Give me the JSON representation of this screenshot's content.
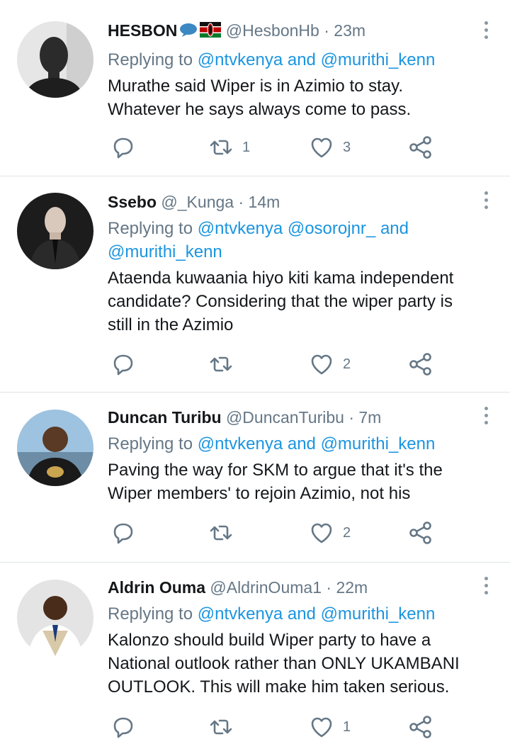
{
  "tweets": [
    {
      "name": "HESBON",
      "handle": "@HesbonHb",
      "dot": "·",
      "time": "23m",
      "reply_prefix": "Replying to",
      "reply_mention1": "@ntvkenya",
      "reply_and": "and",
      "reply_mention2": "@murithi_kenn",
      "text1": "Murathe said Wiper is in Azimio to stay.",
      "text2": "Whatever he says always come to pass.",
      "retweets": "1",
      "likes": "3"
    },
    {
      "name": "Ssebo",
      "handle": "@_Kunga",
      "dot": "·",
      "time": "14m",
      "reply_prefix": "Replying to",
      "reply_mention1": "@ntvkenya",
      "reply_mention2": "@osorojnr_",
      "reply_and": "and",
      "reply_mention3": "@murithi_kenn",
      "text1": "Ataenda kuwaania hiyo kiti kama independent",
      "text2": "candidate? Considering that the wiper party is",
      "text3": "still in the Azimio",
      "retweets": "",
      "likes": "2"
    },
    {
      "name": "Duncan Turibu",
      "handle": "@DuncanTuribu",
      "dot": "·",
      "time": "7m",
      "reply_prefix": "Replying to",
      "reply_mention1": "@ntvkenya",
      "reply_and": "and",
      "reply_mention2": "@murithi_kenn",
      "text1": "Paving the way for SKM to argue that it's the",
      "text2": "Wiper members' to rejoin Azimio, not his",
      "retweets": "",
      "likes": "2"
    },
    {
      "name": "Aldrin Ouma",
      "handle": "@AldrinOuma1",
      "dot": "·",
      "time": "22m",
      "reply_prefix": "Replying to",
      "reply_mention1": "@ntvkenya",
      "reply_and": "and",
      "reply_mention2": "@murithi_kenn",
      "text1": "Kalonzo should build Wiper party to have a",
      "text2": "National outlook rather than ONLY UKAMBANI",
      "text3": "OUTLOOK. This will make him taken serious.",
      "retweets": "",
      "likes": "1"
    }
  ],
  "colors": {
    "accent": "#1b95e0",
    "muted": "#657786",
    "text": "#14171a",
    "divider": "#dfe3e6"
  },
  "icons": [
    "reply-icon",
    "retweet-icon",
    "like-icon",
    "share-icon",
    "more-options-icon",
    "speech-bubble-emoji",
    "kenya-flag-emoji"
  ]
}
